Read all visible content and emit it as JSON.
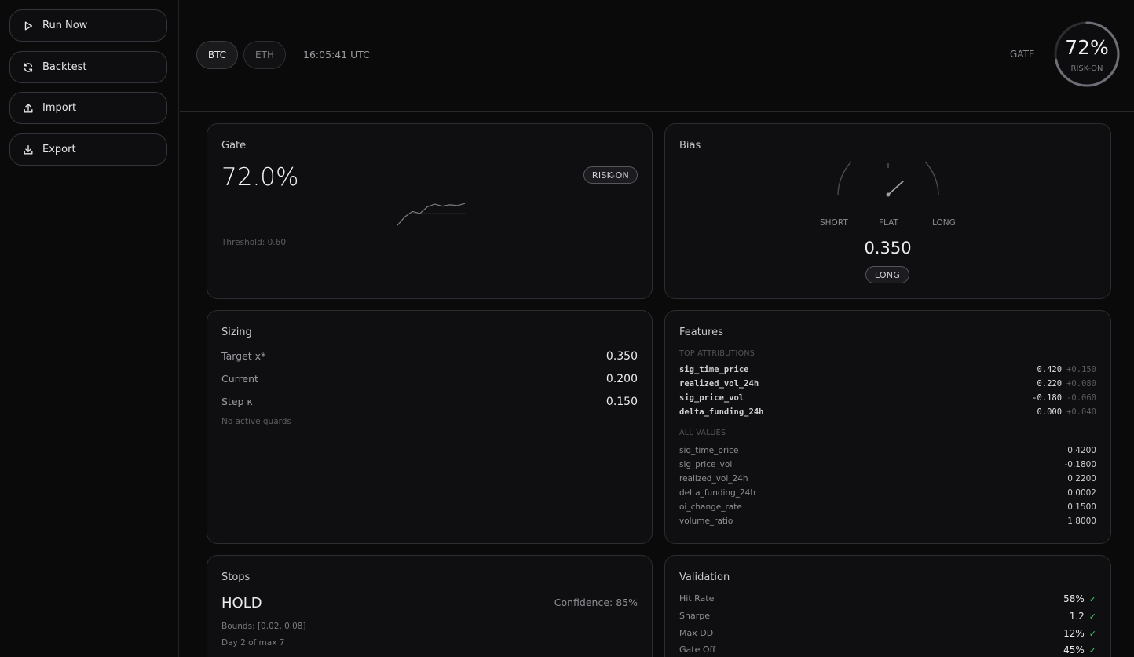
{
  "sidebar": {
    "buttons": [
      {
        "label": "Run Now",
        "icon": "play-icon"
      },
      {
        "label": "Backtest",
        "icon": "refresh-icon"
      },
      {
        "label": "Import",
        "icon": "upload-icon"
      },
      {
        "label": "Export",
        "icon": "download-icon"
      }
    ]
  },
  "header": {
    "assets": [
      "BTC",
      "ETH"
    ],
    "active_asset": "BTC",
    "time": "16:05:41 UTC",
    "gate_label": "GATE",
    "gate_pct": "72%",
    "gate_fraction": 0.72,
    "gate_state": "RISK-ON"
  },
  "gate_card": {
    "title": "Gate",
    "value": "72.0%",
    "badge": "RISK-ON",
    "threshold": "Threshold: 0.60",
    "sparkline": [
      0.42,
      0.55,
      0.63,
      0.6,
      0.7,
      0.74,
      0.71,
      0.73,
      0.72,
      0.75
    ]
  },
  "bias_card": {
    "title": "Bias",
    "labels": {
      "short": "SHORT",
      "flat": "FLAT",
      "long": "LONG"
    },
    "value": "0.350",
    "value_num": 0.35,
    "badge": "LONG"
  },
  "sizing_card": {
    "title": "Sizing",
    "rows": [
      {
        "label": "Target x*",
        "value": "0.350"
      },
      {
        "label": "Current",
        "value": "0.200"
      },
      {
        "label": "Step κ",
        "value": "0.150"
      }
    ],
    "note": "No active guards"
  },
  "features_card": {
    "title": "Features",
    "top_label": "TOP ATTRIBUTIONS",
    "top": [
      {
        "name": "sig_time_price",
        "value": "0.420",
        "delta": "+0.150"
      },
      {
        "name": "realized_vol_24h",
        "value": "0.220",
        "delta": "+0.080"
      },
      {
        "name": "sig_price_vol",
        "value": "-0.180",
        "delta": "-0.060"
      },
      {
        "name": "delta_funding_24h",
        "value": "0.000",
        "delta": "+0.040"
      }
    ],
    "all_label": "ALL VALUES",
    "all": [
      {
        "name": "sig_time_price",
        "value": "0.4200"
      },
      {
        "name": "sig_price_vol",
        "value": "-0.1800"
      },
      {
        "name": "realized_vol_24h",
        "value": "0.2200"
      },
      {
        "name": "delta_funding_24h",
        "value": "0.0002"
      },
      {
        "name": "oi_change_rate",
        "value": "0.1500"
      },
      {
        "name": "volume_ratio",
        "value": "1.8000"
      }
    ]
  },
  "stops_card": {
    "title": "Stops",
    "action": "HOLD",
    "confidence": "Confidence: 85%",
    "bounds": "Bounds: [0.02, 0.08]",
    "day": "Day 2 of max 7"
  },
  "validation_card": {
    "title": "Validation",
    "rows": [
      {
        "label": "Hit Rate",
        "value": "58%",
        "check": "✓"
      },
      {
        "label": "Sharpe",
        "value": "1.2",
        "check": "✓"
      },
      {
        "label": "Max DD",
        "value": "12%",
        "check": "✓"
      },
      {
        "label": "Gate Off",
        "value": "45%",
        "check": "✓"
      }
    ]
  }
}
